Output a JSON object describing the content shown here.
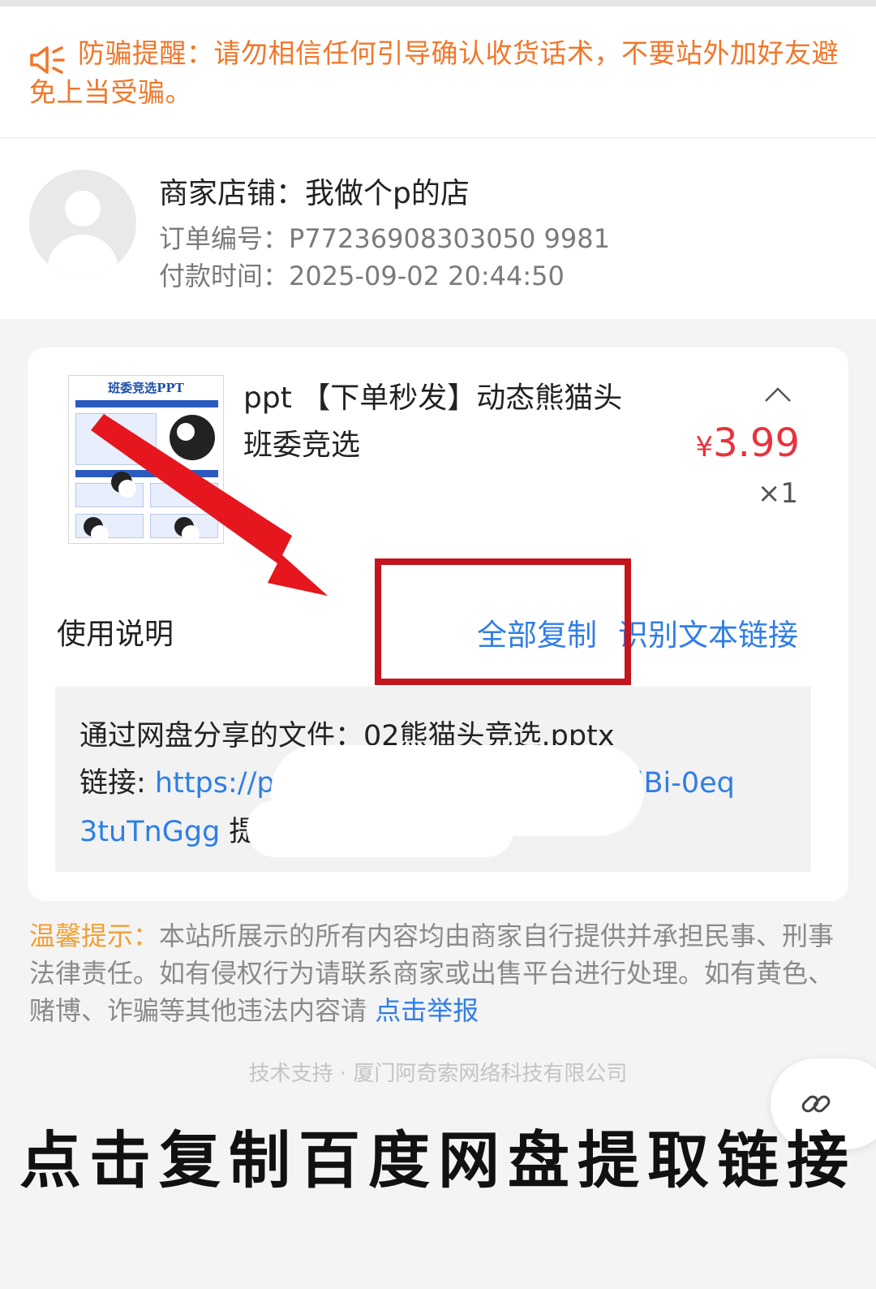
{
  "notice": {
    "text": "防骗提醒：请勿相信任何引导确认收货话术，不要站外加好友避免上当受骗。",
    "icon": "speaker-icon"
  },
  "merchant": {
    "shop": "商家店铺：我做个p的店",
    "order_no": "订单编号：P77236908303050 9981",
    "pay_time": "付款时间：2025-09-02 20:44:50"
  },
  "product": {
    "thumb_title": "班委竞选PPT",
    "title": "ppt 【下单秒发】动态熊猫头班委竞选",
    "currency": "¥",
    "price": "3.99",
    "qty": "×1"
  },
  "usage": {
    "label": "使用说明",
    "copy_all": "全部复制",
    "recognize_link": "识别文本链接"
  },
  "content": {
    "file_line": "通过网盘分享的文件：02熊猫头竞选.pptx",
    "link_label": "链接: ",
    "link_start": "https://p",
    "link_end": "-dBi-0eq",
    "link_tail": "3tuTnGgg",
    "after_link": " 提"
  },
  "tip": {
    "label": "温馨提示：",
    "body": "本站所展示的所有内容均由商家自行提供并承担民事、刑事法律责任。如有侵权行为请联系商家或出售平台进行处理。如有黄色、赌博、诈骗等其他违法内容请 ",
    "report": "点击举报"
  },
  "footer": {
    "tech": "技术支持 · 厦门阿奇索网络科技有限公司"
  },
  "caption": "点击复制百度网盘提取链接",
  "colors": {
    "orange": "#f0772a",
    "blue": "#2f7ee6",
    "price_red": "#e8323d",
    "annotation_red": "#c4141c"
  }
}
